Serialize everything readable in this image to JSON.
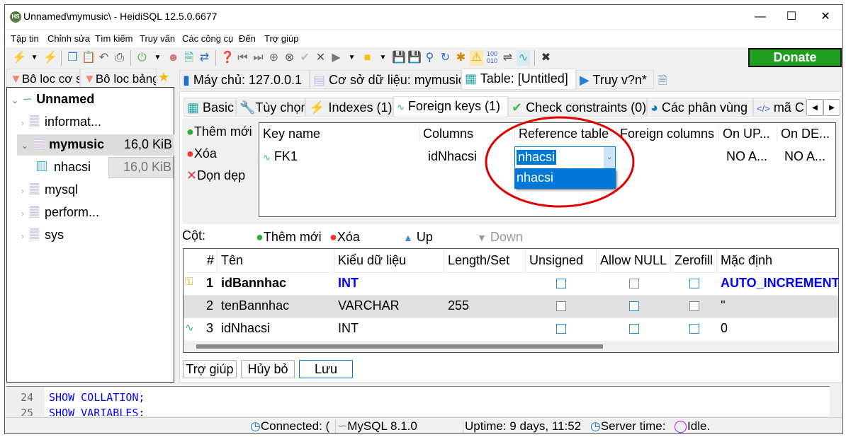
{
  "window": {
    "title": "Unnamed\\mymusic\\ - HeidiSQL 12.5.0.6677",
    "app_icon": "HS",
    "controls": [
      "minimize-icon",
      "maximize-icon",
      "close-icon"
    ]
  },
  "menu": [
    "Tập tin",
    "Chỉnh sửa",
    "Tìm kiếm",
    "Truy vấn",
    "Các công cụ",
    "Đến",
    "Trợ giúp"
  ],
  "toolbar": {
    "icons": [
      "connect-icon",
      "dropdown-icon",
      "disconnect-icon",
      "copy-icon",
      "paste-icon",
      "undo-icon",
      "print-icon",
      "refresh-icon",
      "dropdown-icon",
      "users-icon",
      "export-csv-icon",
      "import-icon",
      "help-icon",
      "first-icon",
      "last-icon",
      "add-icon",
      "cancel-icon",
      "apply-icon",
      "delete-icon",
      "run-icon",
      "dropdown-icon",
      "folder-icon",
      "dropdown-icon",
      "save-icon",
      "save-as-icon",
      "search-icon",
      "replace-icon",
      "broom-icon",
      "warning-icon",
      "binary-icon",
      "wrap-icon",
      "format-icon",
      "close-tab-icon"
    ],
    "donate": "Donate"
  },
  "left_tabs": [
    "Bô loc cơ sở dữ liệu",
    "Bô loc bảng"
  ],
  "tree": {
    "root": "Unnamed",
    "items": [
      {
        "name": "informat...",
        "size": ""
      },
      {
        "name": "mymusic",
        "size": "16,0 KiB",
        "expanded": true,
        "children": [
          {
            "name": "nhacsi",
            "size": "16,0 KiB"
          }
        ]
      },
      {
        "name": "mysql",
        "size": ""
      },
      {
        "name": "perform...",
        "size": ""
      },
      {
        "name": "sys",
        "size": ""
      }
    ]
  },
  "main_tabs": [
    "Máy chủ: 127.0.0.1",
    "Cơ sở dữ liệu: mymusic",
    "Table: [Untitled]",
    "Truy v?n*"
  ],
  "sub_tabs": [
    "Basic",
    "Tùy chọn",
    "Indexes (1)",
    "Foreign keys (1)",
    "Check constraints (0)",
    "Các phân vùng",
    "mã CREATE"
  ],
  "fk": {
    "actions": [
      "Thêm mới",
      "Xóa",
      "Dọn dẹp"
    ],
    "headers": [
      "Key name",
      "Columns",
      "Reference table",
      "Foreign columns",
      "On UP...",
      "On DE..."
    ],
    "rows": [
      {
        "key": "FK1",
        "columns": "idNhacsi",
        "reference": "nhacsi",
        "foreign": "",
        "on_update": "NO A...",
        "on_delete": "NO A..."
      }
    ],
    "dropdown_options": [
      "nhacsi"
    ]
  },
  "columns": {
    "label": "Cột:",
    "add": "Thêm mới",
    "delete": "Xóa",
    "up": "Up",
    "down": "Down",
    "headers": [
      "#",
      "Tên",
      "Kiểu dữ liệu",
      "Length/Set",
      "Unsigned",
      "Allow NULL",
      "Zerofill",
      "Mặc định"
    ],
    "rows": [
      {
        "n": "1",
        "name": "idBannhac",
        "type": "INT",
        "length": "",
        "unsigned": false,
        "null": false,
        "zerofill": false,
        "default": "AUTO_INCREMENT",
        "icon": "primary-key-icon"
      },
      {
        "n": "2",
        "name": "tenBannhac",
        "type": "VARCHAR",
        "length": "255",
        "unsigned": false,
        "null": false,
        "zerofill": false,
        "default": "''"
      },
      {
        "n": "3",
        "name": "idNhacsi",
        "type": "INT",
        "length": "",
        "unsigned": false,
        "null": false,
        "zerofill": false,
        "default": "0",
        "icon": "foreign-key-icon"
      }
    ]
  },
  "buttons": {
    "help": "Trợ giúp",
    "cancel": "Hủy bỏ",
    "save": "Lưu"
  },
  "sql_log": [
    {
      "line": "24",
      "text": "SHOW COLLATION;"
    },
    {
      "line": "25",
      "text": "SHOW VARIABLES;"
    }
  ],
  "status": {
    "connected": "Connected: (",
    "server": "MySQL 8.1.0",
    "uptime": "Uptime: 9 days, 11:52",
    "server_time": "Server time:",
    "idle": "Idle."
  },
  "colors": {
    "accent": "#0078d7",
    "donate": "#1f9e1f",
    "highlight_circle": "#e00000",
    "keyword": "#0000ff"
  }
}
